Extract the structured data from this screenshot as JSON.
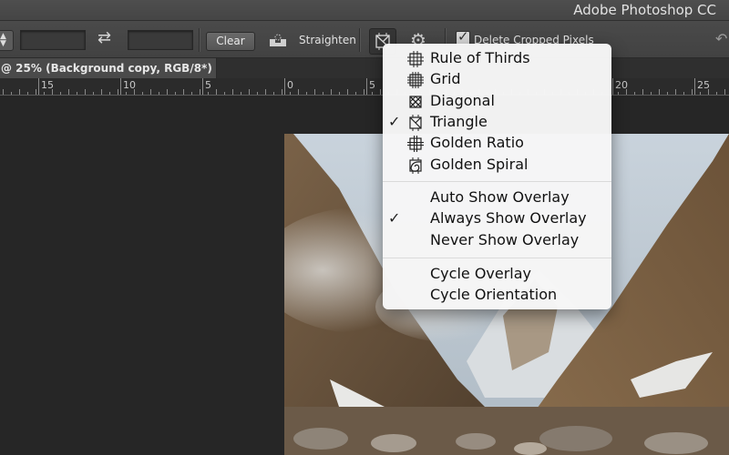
{
  "app": {
    "title": "Adobe Photoshop CC"
  },
  "options_bar": {
    "stepper_icon": "up-down-arrows-icon",
    "width_field": "",
    "swap_icon": "swap-arrows-icon",
    "height_field": "",
    "clear_label": "Clear",
    "straighten_icon": "straighten-level-icon",
    "straighten_label": "Straighten",
    "overlay_icon": "triangle-overlay-icon",
    "settings_icon": "gear-icon",
    "delete_cropped_checked": true,
    "delete_cropped_label": "Delete Cropped Pixels",
    "reset_icon": "reset-icon"
  },
  "document": {
    "tab_label": "@ 25% (Background copy, RGB/8*) *"
  },
  "ruler": {
    "labels": [
      "15",
      "10",
      "5",
      "0",
      "5",
      "20",
      "25"
    ]
  },
  "overlay_menu": {
    "overlays": [
      {
        "label": "Rule of Thirds",
        "icon": "rule-of-thirds-icon",
        "checked": false
      },
      {
        "label": "Grid",
        "icon": "grid-icon",
        "checked": false
      },
      {
        "label": "Diagonal",
        "icon": "diagonal-icon",
        "checked": false
      },
      {
        "label": "Triangle",
        "icon": "triangle-icon",
        "checked": true
      },
      {
        "label": "Golden Ratio",
        "icon": "golden-ratio-icon",
        "checked": false
      },
      {
        "label": "Golden Spiral",
        "icon": "golden-spiral-icon",
        "checked": false
      }
    ],
    "show_modes": [
      {
        "label": "Auto Show Overlay",
        "checked": false
      },
      {
        "label": "Always Show Overlay",
        "checked": true
      },
      {
        "label": "Never Show Overlay",
        "checked": false
      }
    ],
    "actions": [
      {
        "label": "Cycle Overlay"
      },
      {
        "label": "Cycle Orientation"
      }
    ],
    "check_glyph": "✓"
  },
  "canvas": {
    "image_description": "Mountain valley with snow, mist and rocky riverbed"
  }
}
